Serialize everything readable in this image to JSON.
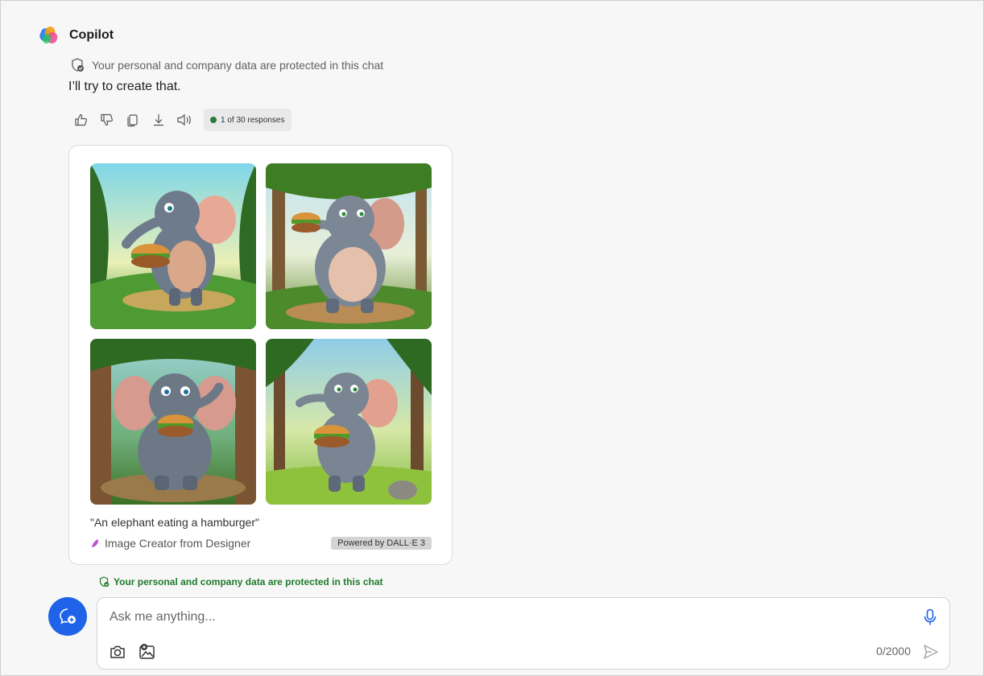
{
  "header": {
    "title": "Copilot"
  },
  "message": {
    "protected_text": "Your personal and company data are protected in this chat",
    "reply_text": "I’ll try to create that.",
    "responses_badge": "1 of 30 responses"
  },
  "image_card": {
    "caption": "\"An elephant eating a hamburger\"",
    "creator_label": "Image Creator from Designer",
    "powered_label": "Powered by DALL·E 3",
    "images": [
      {
        "name": "elephant-image-1"
      },
      {
        "name": "elephant-image-2"
      },
      {
        "name": "elephant-image-3"
      },
      {
        "name": "elephant-image-4"
      }
    ]
  },
  "footer": {
    "protected_text": "Your personal and company data are protected in this chat"
  },
  "input": {
    "placeholder": "Ask me anything...",
    "value": "",
    "counter": "0/2000"
  },
  "colors": {
    "accent": "#1f63e8",
    "protected_green": "#1e7b2b",
    "background": "#f7f7f7"
  }
}
